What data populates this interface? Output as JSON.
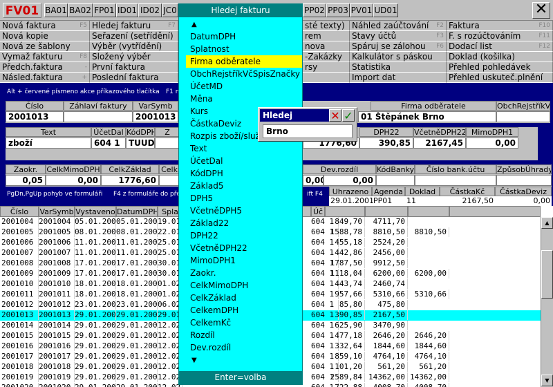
{
  "top": {
    "code": "FV01",
    "tabs": [
      "BA01",
      "BA02",
      "FP01",
      "ID01",
      "ID02",
      "JC0",
      "PP02",
      "PP03",
      "PV01",
      "UD01"
    ],
    "close": "✕"
  },
  "menu": {
    "col1": [
      {
        "label": "Nová faktura",
        "key": "F5"
      },
      {
        "label": "Nová kopie",
        "key": ""
      },
      {
        "label": "Nová ze šablony",
        "key": ""
      },
      {
        "label": "Vymaž fakturu",
        "key": "F8"
      },
      {
        "label": "Předch.faktura",
        "key": "-"
      },
      {
        "label": "Násled.faktura",
        "key": "+"
      }
    ],
    "col2": [
      {
        "label": "Hledej fakturu",
        "key": "F7"
      },
      {
        "label": "Seřazení (setřídění)",
        "key": ""
      },
      {
        "label": "Výběr (vytřídění)",
        "key": ""
      },
      {
        "label": "Složený výběr",
        "key": ""
      },
      {
        "label": "První faktura",
        "key": ""
      },
      {
        "label": "Poslední faktura",
        "key": ""
      }
    ],
    "col3": [
      {
        "label": "sté texty)",
        "key": ""
      },
      {
        "label": "rem",
        "key": ""
      },
      {
        "label": "nova",
        "key": ""
      },
      {
        "label": "-Zakázky",
        "key": ""
      },
      {
        "label": "rsy",
        "key": ""
      },
      {
        "label": "",
        "key": ""
      }
    ],
    "col4": [
      {
        "label": "Náhled zaúčtování",
        "key": "F2"
      },
      {
        "label": "Stavy účtů",
        "key": "F3"
      },
      {
        "label": "Spáruj se zálohou",
        "key": "F6"
      },
      {
        "label": "Kalkulátor s páskou",
        "key": ""
      },
      {
        "label": "Statistika",
        "key": ""
      },
      {
        "label": "Import dat",
        "key": ""
      }
    ],
    "col5": [
      {
        "label": "Faktura",
        "key": "F10"
      },
      {
        "label": "F. s rozúčtováním",
        "key": "F11"
      },
      {
        "label": "Dodací list",
        "key": "F12"
      },
      {
        "label": "Doklad (košilka)",
        "key": ""
      },
      {
        "label": "Přehled pohledávek",
        "key": ""
      },
      {
        "label": "Přehled uskuteč.plnění",
        "key": ""
      }
    ]
  },
  "hints": {
    "top": "Alt + červené písmeno akce příkazového tlačítka",
    "top_right": "F1 n",
    "bottom": "PgDn,PgUp pohyb ve formuláři",
    "bottom2": "F4 z formuláře do přehledu",
    "bottom_right": "ift F4"
  },
  "form": {
    "row1_headers": [
      "Číslo",
      "Záhlaví faktury",
      "VarSymb",
      "",
      "Firma odběratele",
      "ObchRejstříkVč"
    ],
    "row1_values": [
      "2001013",
      "",
      "2001013",
      "01",
      "Štěpánek Brno",
      ""
    ],
    "row2_headers": [
      "Text",
      "ÚčetDal",
      "KódDPH",
      "Z",
      "DPH22",
      "VčetněDPH22",
      "MimoDPH1"
    ],
    "row2_values": [
      "zboží",
      "604 1",
      "TUUD",
      "",
      "1776,60",
      "390,85",
      "2167,45",
      "0,00"
    ],
    "row3_headers": [
      "Zaokr.",
      "CelkMimoDPH",
      "CelkZáklad",
      "Celk",
      "Dev.rozdíl",
      "KódBanky",
      "Číslo bank.účtu",
      "ZpůsobÚhrady"
    ],
    "row3_values": [
      "0,05",
      "0,00",
      "1776,60",
      "",
      "0,00",
      "0,00"
    ]
  },
  "payments": {
    "headers": [
      "Uhrazeno",
      "Agenda",
      "Doklad",
      "ČástkaKč",
      "ČástkaDeviz"
    ],
    "rows": [
      [
        "29.01.2001",
        "PP01",
        "11",
        "2167,50",
        "0,00"
      ]
    ]
  },
  "dropdown": {
    "title": "Hledej fakturu",
    "footer": "Enter=volba",
    "selected_index": 2,
    "items": [
      "DatumDPH",
      "Splatnost",
      "Firma odběratele",
      "ObchRejstříkVčSpisZnačky",
      "ÚčetMD",
      "Měna",
      "Kurs",
      "ČástkaDeviz",
      "Rozpis zboží/služ",
      "Text",
      "ÚčetDal",
      "KódDPH",
      "Základ5",
      "DPH5",
      "VčetněDPH5",
      "Základ22",
      "DPH22",
      "VčetněDPH22",
      "MimoDPH1",
      "Zaokr.",
      "CelkMimoDPH",
      "CelkZáklad",
      "CelkemDPH",
      "CelkemKč",
      "Rozdíl",
      "Dev.rozdíl"
    ]
  },
  "search": {
    "title": "Hledej",
    "value": "Brno"
  },
  "grid": {
    "headers": [
      "Číslo",
      "VarSymb",
      "Vystaveno",
      "DatumDPH",
      "Spla",
      "",
      "Úč",
      "",
      "",
      "",
      ""
    ],
    "selected_index": 9,
    "rows": [
      [
        "2001004",
        "2001004",
        "05.01.2001",
        "05.01.2001",
        "19.01",
        "604 1",
        "849,70",
        "4711,70",
        ""
      ],
      [
        "2001005",
        "2001005",
        "08.01.2001",
        "08.01.2001",
        "22.01",
        "604 1",
        "1588,78",
        "8810,50",
        "8810,50"
      ],
      [
        "2001006",
        "2001006",
        "11.01.2001",
        "11.01.2001",
        "25.01",
        "604 1",
        "455,18",
        "2524,20",
        ""
      ],
      [
        "2001007",
        "2001007",
        "11.01.2001",
        "11.01.2001",
        "25.01",
        "604 1",
        "442,86",
        "2456,00",
        ""
      ],
      [
        "2001008",
        "2001008",
        "17.01.2001",
        "17.01.2001",
        "30.01",
        "604 1",
        "1787,50",
        "9912,50",
        ""
      ],
      [
        "2001009",
        "2001009",
        "17.01.2001",
        "17.01.2001",
        "30.01",
        "604 1",
        "1118,04",
        "6200,00",
        "6200,00"
      ],
      [
        "2001010",
        "2001010",
        "18.01.2001",
        "18.01.2001",
        "01.02",
        "604 1",
        "443,74",
        "2460,74",
        ""
      ],
      [
        "2001011",
        "2001011",
        "18.01.2001",
        "18.01.2001",
        "01.02",
        "604 1",
        "957,66",
        "5310,66",
        "5310,66"
      ],
      [
        "2001012",
        "2001012",
        "23.01.2001",
        "23.01.2001",
        "06.02",
        "604 1",
        "85,80",
        "475,80",
        ""
      ],
      [
        "2001013",
        "2001013",
        "29.01.2001",
        "29.01.2001",
        "29.01",
        "604 1",
        "390,85",
        "2167,50",
        ""
      ],
      [
        "2001014",
        "2001014",
        "29.01.2001",
        "29.01.2001",
        "12.02",
        "604 1",
        "625,90",
        "3470,90",
        ""
      ],
      [
        "2001015",
        "2001015",
        "29.01.2001",
        "29.01.2001",
        "12.02",
        "604 1",
        "477,18",
        "2646,20",
        "2646,20"
      ],
      [
        "2001016",
        "2001016",
        "29.01.2001",
        "29.01.2001",
        "12.02",
        "604 1",
        "332,64",
        "1844,60",
        "1844,60"
      ],
      [
        "2001017",
        "2001017",
        "29.01.2001",
        "29.01.2001",
        "12.02",
        "604 1",
        "859,10",
        "4764,10",
        "4764,10"
      ],
      [
        "2001018",
        "2001018",
        "29.01.2001",
        "29.01.2001",
        "12.02",
        "604 1",
        "101,20",
        "561,20",
        "561,20"
      ],
      [
        "2001019",
        "2001019",
        "29.01.2001",
        "29.01.2001",
        "12.02",
        "604 1",
        "2589,84",
        "14362,00",
        "14362,00"
      ],
      [
        "2001020",
        "2001020",
        "29.01.2001",
        "29.01.2001",
        "12.02",
        "604 1",
        "722,88",
        "4008,70",
        "4008,70"
      ]
    ]
  }
}
